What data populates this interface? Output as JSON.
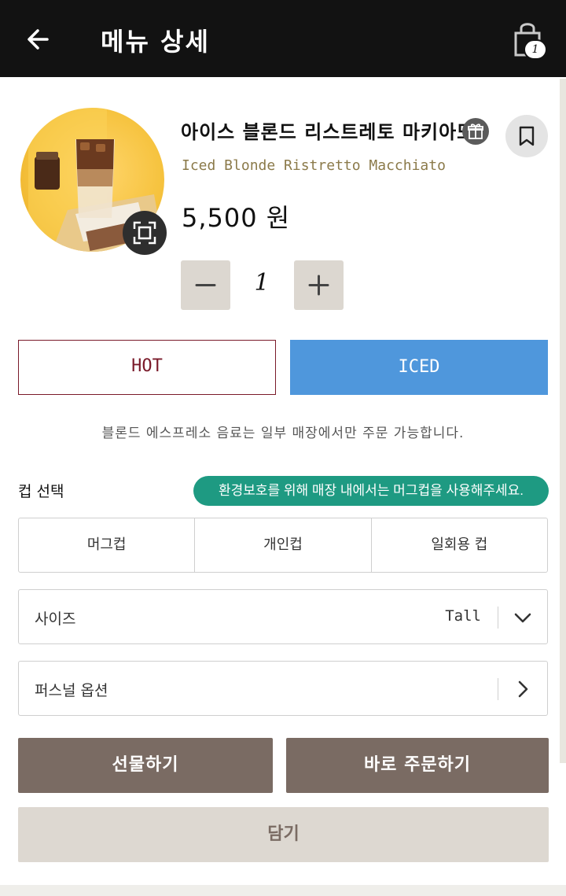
{
  "header": {
    "title": "메뉴 상세",
    "cart_count": "1"
  },
  "product": {
    "name_ko": "아이스 블론드 리스트레토 마키아또",
    "name_en": "Iced Blonde Ristretto Macchiato",
    "price": "5,500 원",
    "quantity": "1"
  },
  "temperature": {
    "hot_label": "HOT",
    "iced_label": "ICED",
    "selected": "ICED"
  },
  "notice": "블론드 에스프레소 음료는 일부 매장에서만 주문 가능합니다.",
  "cup": {
    "label": "컵 선택",
    "eco_message": "환경보호를 위해 매장 내에서는 머그컵을 사용해주세요.",
    "options": [
      "머그컵",
      "개인컵",
      "일회용 컵"
    ]
  },
  "size": {
    "label": "사이즈",
    "value": "Tall"
  },
  "personal_option": {
    "label": "퍼스널 옵션"
  },
  "actions": {
    "gift_label": "선물하기",
    "order_label": "바로 주문하기",
    "cart_label": "담기"
  },
  "colors": {
    "topbar": "#121212",
    "iced_selected": "#4f97dc",
    "hot_border": "#7a1a2a",
    "eco_pill": "#1e9a82",
    "primary_button": "#7a6b63",
    "secondary_button": "#ddd8d1"
  },
  "icons": [
    "back-arrow-icon",
    "shopping-bag-icon",
    "gift-icon",
    "bookmark-icon",
    "fullscreen-icon",
    "minus-icon",
    "plus-icon",
    "chevron-down-icon",
    "chevron-right-icon"
  ]
}
